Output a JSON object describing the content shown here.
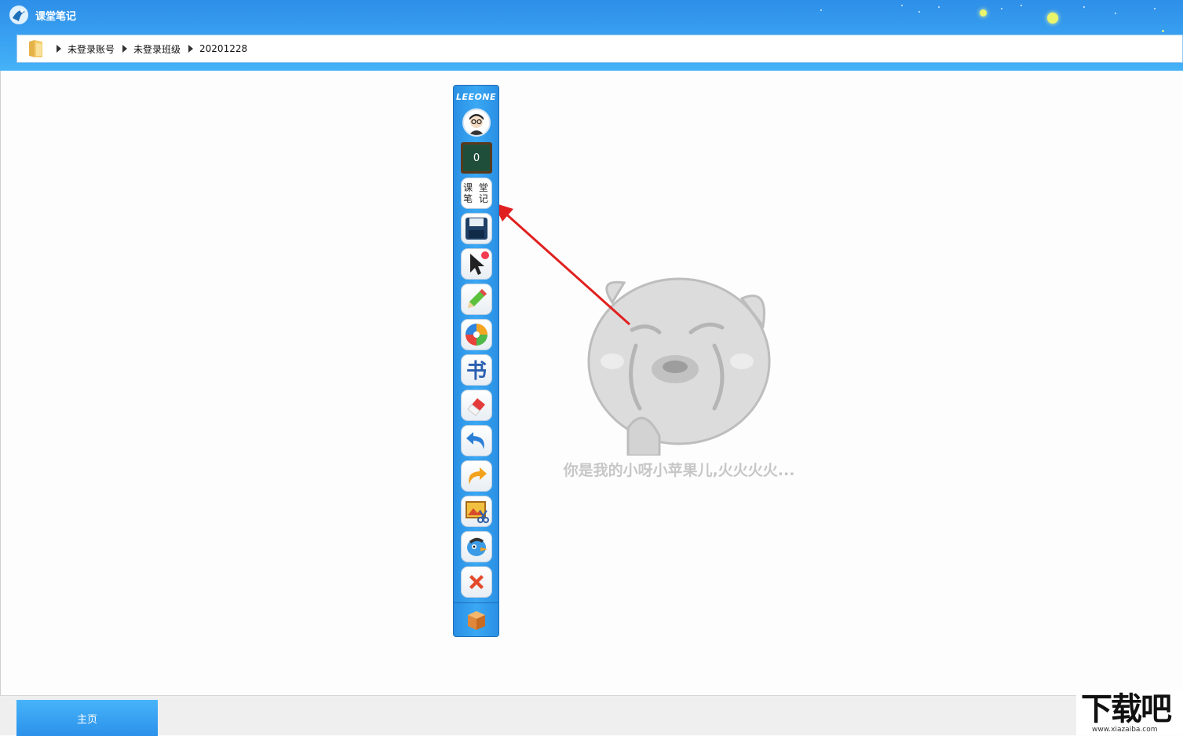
{
  "window": {
    "title": "课堂笔记"
  },
  "breadcrumb": {
    "items": [
      "未登录账号",
      "未登录班级",
      "20201228"
    ]
  },
  "toolbar": {
    "brand": "LEEONE",
    "page_counter": "0",
    "note_label_line1": "课 堂",
    "note_label_line2": "笔 记"
  },
  "canvas": {
    "empty_message": "你是我的小呀小苹果儿,火火火火..."
  },
  "bottom": {
    "home_label": "主页"
  },
  "watermark": {
    "text": "下载吧",
    "url": "www.xiazaiba.com"
  },
  "colors": {
    "accent": "#2e8fe8",
    "arrow": "#e02020"
  }
}
